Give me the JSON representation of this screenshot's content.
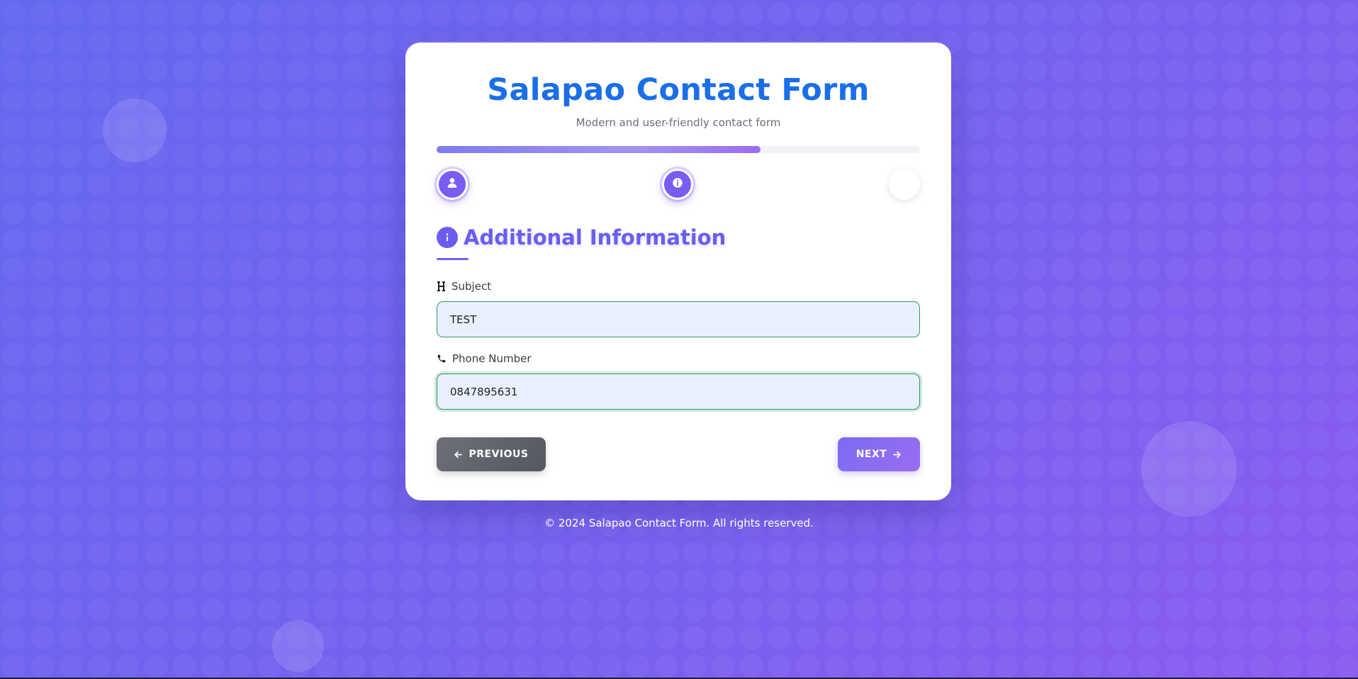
{
  "form": {
    "title": "Salapao Contact Form",
    "subtitle": "Modern and user-friendly contact form",
    "progress_percent": 67,
    "steps": [
      {
        "icon": "user-icon",
        "state": "active"
      },
      {
        "icon": "info-icon",
        "state": "active"
      },
      {
        "icon": "",
        "state": "pending"
      }
    ],
    "section": {
      "icon": "info-icon",
      "title": "Additional Information"
    },
    "fields": {
      "subject": {
        "icon": "heading-icon",
        "label": "Subject",
        "value": "TEST"
      },
      "phone": {
        "icon": "phone-icon",
        "label": "Phone Number",
        "value": "0847895631"
      }
    },
    "buttons": {
      "previous": {
        "label": "PREVIOUS",
        "icon": "arrow-left-icon"
      },
      "next": {
        "label": "NEXT",
        "icon": "arrow-right-icon"
      }
    }
  },
  "footer": {
    "text": "© 2024 Salapao Contact Form. All rights reserved."
  },
  "colors": {
    "title": "#1a6ee8",
    "accent": "#6a5ef0",
    "input_border": "#2f9a62",
    "input_bg": "#e9f0fd",
    "previous_button": "#5f636a"
  }
}
